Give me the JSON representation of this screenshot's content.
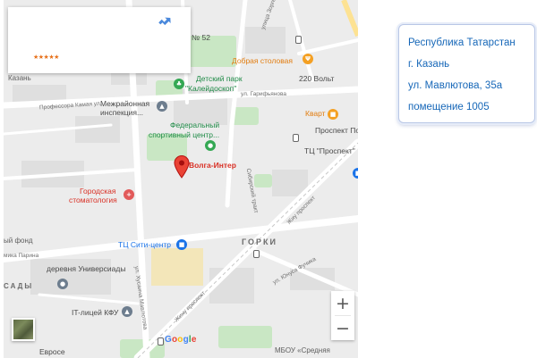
{
  "map": {
    "info_card": {
      "rating_stars": "★★★★★",
      "directions_icon": "directions-icon"
    },
    "labels": {
      "no52": "№ 52",
      "dobraya_stolovaya": "Добрая столовая",
      "detskiy_park_1": "Детский парк",
      "detskiy_park_2": "\"Калейдоскоп\"",
      "address_220": "220 Вольт",
      "kazan": "Казань",
      "professora_kamaya": "Профессора Камая ул.",
      "mezhrayonnaya_1": "Межрайонная",
      "mezhrayonnaya_2": "инспекция...",
      "ul_garifullina": "ул. Гарифьянова",
      "kvart": "Кварт",
      "fed_center_1": "Федеральный",
      "fed_center_2": "спортивный центр...",
      "prospekt_pobedy": "Проспект Побе",
      "tc_prospekt": "ТЦ \"Проспект\"",
      "volga_inter": "Волга-Интер",
      "gor_stom_1": "Городская",
      "gor_stom_2": "стоматология",
      "fond": "ый фонд",
      "ul_parina": "мика Парина",
      "tc_siti": "ТЦ Сити-центр",
      "gorki": "ГОРКИ",
      "derevnya_1": "деревня Универсиады",
      "sady": "САДЫ",
      "it_licey": "IT-лицей КФУ",
      "mbou": "МБОУ «Средняя",
      "evroe": "Евросе",
      "ul_zorge": "улица Зорге",
      "ul_mavlyutova": "ул. Хусаина Мавлютова",
      "zhiru_prospekt": "Жиу проспект",
      "zhiru_prospekt_2": "Жину проспект",
      "ul_yunusa": "ул. Юнуса Фучика",
      "ul_sibirsky": "Сибирский тракт"
    },
    "zoom_in": "+",
    "zoom_out": "−",
    "google_letters": [
      "G",
      "o",
      "o",
      "g",
      "l",
      "e"
    ],
    "google_colors": [
      "#4285f4",
      "#ea4335",
      "#fbbc05",
      "#4285f4",
      "#34a853",
      "#ea4335"
    ],
    "colors": {
      "marker": "#ea4335",
      "park": "#c9e7c4",
      "road": "#ffffff",
      "highlight_road": "#fde293"
    }
  },
  "address": {
    "line1": "Республика Татарстан",
    "line2": "г. Казань",
    "line3": "ул. Мавлютова, 35а",
    "line4": "помещение 1005"
  }
}
